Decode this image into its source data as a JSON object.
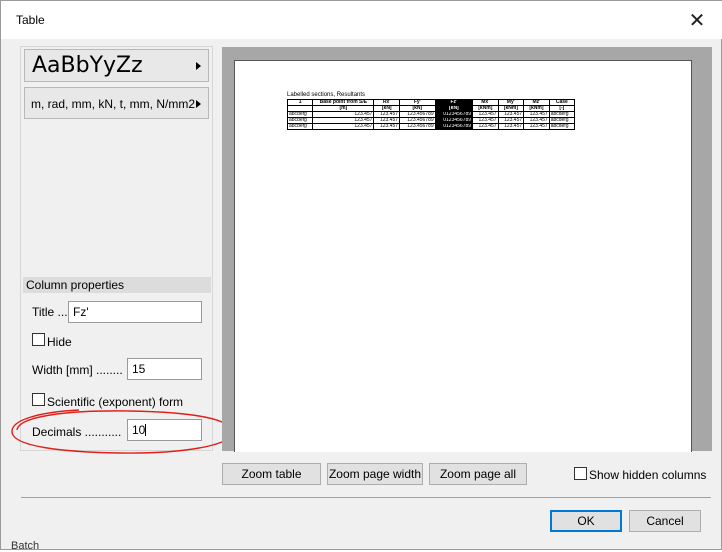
{
  "window": {
    "title": "Table"
  },
  "left_panel": {
    "font_button_label": "AaBbYyZz",
    "units_button_label": "m, rad, mm, kN, t, mm, N/mm2"
  },
  "column_properties": {
    "header": "Column properties",
    "title_label": "Title ...",
    "title_value": "Fz'",
    "hide_label": "Hide",
    "hide_checked": false,
    "width_label": "Width [mm] ........",
    "width_value": "15",
    "scientific_label": "Scientific (exponent) form",
    "scientific_checked": false,
    "decimals_label": "Decimals ...........",
    "decimals_value": "10"
  },
  "preview": {
    "table_title": "Labelled sections, Resultants",
    "header_row1": [
      "1",
      "Base point from S/E",
      "Rx'",
      "Fy'",
      "Fz'",
      "Mx'",
      "My'",
      "Mz'",
      "Case"
    ],
    "header_row2": [
      "",
      "[m]",
      "[kN]",
      "[kN]",
      "[kN]",
      "[kNm]",
      "[kNm]",
      "[kNm]",
      "[-]"
    ],
    "rows": [
      [
        "abcdefg",
        "123.457",
        "123.457",
        "123.456789",
        "0123456789",
        "123.457",
        "123.457",
        "123.457",
        "abcdefg"
      ],
      [
        "abcdefg",
        "123.457",
        "123.457",
        "123.456789",
        "0123456789",
        "123.457",
        "123.457",
        "123.457",
        "abcdefg"
      ],
      [
        "abcdefg",
        "123.457",
        "123.457",
        "123.456789",
        "0123456789",
        "123.457",
        "123.457",
        "123.457",
        "abcdefg"
      ]
    ]
  },
  "bottom_bar": {
    "zoom_table": "Zoom table",
    "zoom_page_width": "Zoom page width",
    "zoom_page_all": "Zoom page all",
    "show_hidden_label": "Show hidden columns",
    "show_hidden_checked": false,
    "ok": "OK",
    "cancel": "Cancel"
  },
  "background_text": "Batch",
  "colors": {
    "accent": "#0078d7",
    "annotation": "#e0201b"
  }
}
